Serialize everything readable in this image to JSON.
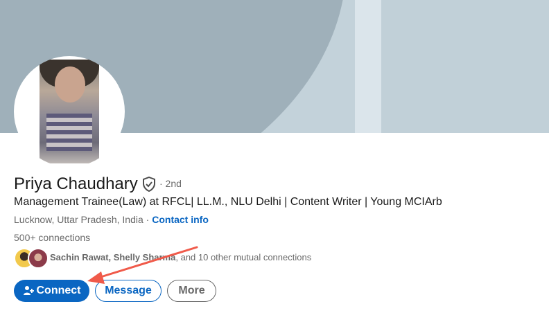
{
  "profile": {
    "name": "Priya Chaudhary",
    "degree": "· 2nd",
    "headline": "Management Trainee(Law) at RFCL| LL.M., NLU Delhi | Content Writer | Young MCIArb",
    "location": "Lucknow, Uttar Pradesh, India",
    "separator": " · ",
    "contact_info": "Contact info",
    "connections": "500+ connections"
  },
  "mutual": {
    "names": "Sachin Rawat, Shelly Sharma",
    "rest": ", and 10 other mutual connections"
  },
  "actions": {
    "connect": "Connect",
    "message": "Message",
    "more": "More"
  },
  "icons": {
    "verified": "shield-check-icon",
    "connect": "person-add-icon"
  },
  "colors": {
    "accent": "#0a66c2",
    "annotation_arrow": "#f05a4a"
  }
}
